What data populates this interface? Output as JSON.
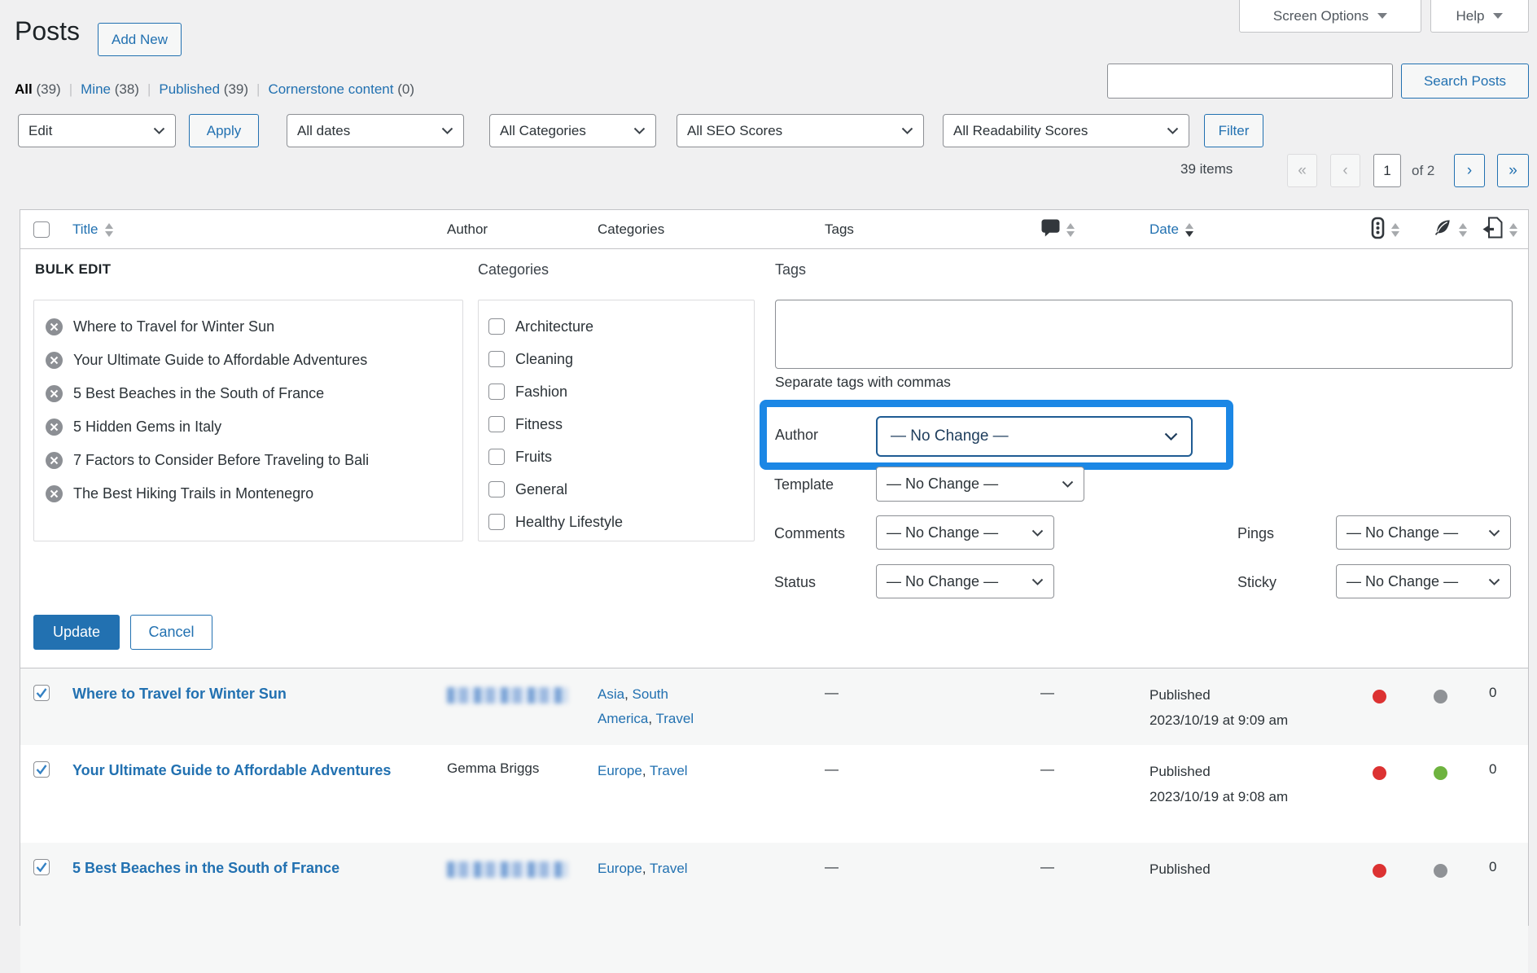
{
  "page": {
    "title": "Posts",
    "add_new_label": "Add New"
  },
  "top_bar": {
    "screen_options_label": "Screen Options",
    "help_label": "Help"
  },
  "views": {
    "separator": "|",
    "items": [
      {
        "label": "All",
        "count": "(39)"
      },
      {
        "label": "Mine",
        "count": "(38)"
      },
      {
        "label": "Published",
        "count": "(39)"
      },
      {
        "label": "Cornerstone content",
        "count": "(0)"
      }
    ]
  },
  "toolbar": {
    "bulk_action": "Edit",
    "apply_label": "Apply",
    "dates": "All dates",
    "categories": "All Categories",
    "seo_scores": "All SEO Scores",
    "readability_scores": "All Readability Scores",
    "filter_label": "Filter"
  },
  "search": {
    "value": "",
    "button_label": "Search Posts"
  },
  "pagination": {
    "items_label": "39 items",
    "first": "«",
    "previous": "‹",
    "current_page": "1",
    "of_label": "of 2",
    "next": "›",
    "last": "»"
  },
  "table": {
    "header": {
      "title": "Title",
      "author": "Author",
      "categories": "Categories",
      "tags": "Tags",
      "date": "Date"
    }
  },
  "bulk_edit": {
    "heading": "BULK EDIT",
    "selected_posts": [
      "Where to Travel for Winter Sun",
      "Your Ultimate Guide to Affordable Adventures",
      "5 Best Beaches in the South of France",
      "5 Hidden Gems in Italy",
      "7 Factors to Consider Before Traveling to Bali",
      "The Best Hiking Trails in Montenegro"
    ],
    "categories_label": "Categories",
    "category_options": [
      "Architecture",
      "Cleaning",
      "Fashion",
      "Fitness",
      "Fruits",
      "General",
      "Healthy Lifestyle"
    ],
    "tags_label": "Tags",
    "tags_value": "",
    "tags_hint": "Separate tags with commas",
    "author_label": "Author",
    "author_value": "— No Change —",
    "template_label": "Template",
    "template_value": "— No Change —",
    "comments_label": "Comments",
    "comments_value": "— No Change —",
    "pings_label": "Pings",
    "pings_value": "— No Change —",
    "status_label": "Status",
    "status_value": "— No Change —",
    "sticky_label": "Sticky",
    "sticky_value": "— No Change —",
    "update_label": "Update",
    "cancel_label": "Cancel"
  },
  "rows": [
    {
      "title": "Where to Travel for Winter Sun",
      "author": "",
      "author_blurred": true,
      "categories": [
        {
          "label": "Asia",
          "sep": ", "
        },
        {
          "label": "South America",
          "sep": ", "
        },
        {
          "label": "Travel",
          "sep": ""
        }
      ],
      "tags": "—",
      "comments": "—",
      "status": "Published",
      "date": "2023/10/19 at 9:09 am",
      "seo_score": "red",
      "readability_score": "gray",
      "link_count": "0"
    },
    {
      "title": "Your Ultimate Guide to Affordable Adventures",
      "author": "Gemma Briggs",
      "author_blurred": false,
      "categories": [
        {
          "label": "Europe",
          "sep": ", "
        },
        {
          "label": "Travel",
          "sep": ""
        }
      ],
      "tags": "—",
      "comments": "—",
      "status": "Published",
      "date": "2023/10/19 at 9:08 am",
      "seo_score": "red",
      "readability_score": "green",
      "link_count": "0"
    },
    {
      "title": "5 Best Beaches in the South of France",
      "author": "",
      "author_blurred": true,
      "categories": [
        {
          "label": "Europe",
          "sep": ", "
        },
        {
          "label": "Travel",
          "sep": ""
        }
      ],
      "tags": "—",
      "comments": "—",
      "status": "Published",
      "date": "",
      "seo_score": "red",
      "readability_score": "gray",
      "link_count": "0"
    }
  ],
  "colors": {
    "accent": "#2271b1",
    "highlight_blue": "#1b87e5",
    "dot_red": "#dc3232",
    "dot_green": "#6eb33f",
    "dot_gray": "#8f9296",
    "page_background": "#f0f0f1"
  }
}
